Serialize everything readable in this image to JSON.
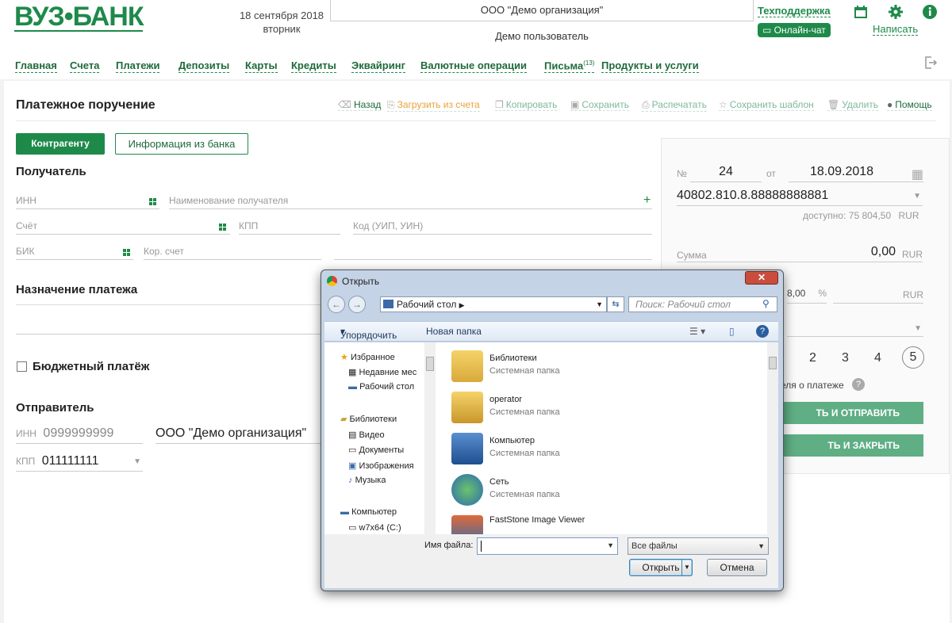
{
  "header": {
    "logo": "ВУЗ•БАНК",
    "date": "18 сентября 2018",
    "weekday": "вторник",
    "org": "ООО \"Демо организация\"",
    "user": "Демо пользователь",
    "support": "Техподдержка",
    "chat": "Онлайн-чат",
    "write": "Написать",
    "icons": [
      "calendar-icon",
      "gear-icon",
      "info-icon",
      "logout-icon"
    ]
  },
  "nav": {
    "items": [
      "Главная",
      "Счета",
      "Платежи",
      "Депозиты",
      "Карты",
      "Кредиты",
      "Эквайринг",
      "Валютные операции",
      "Письма",
      "Продукты и услуги"
    ],
    "letters_badge": "(13)"
  },
  "doc": {
    "title": "Платежное поручение",
    "toolbar": [
      "Назад",
      "Загрузить из счета",
      "Копировать",
      "Сохранить",
      "Распечатать",
      "Сохранить шаблон",
      "Удалить",
      "Помощь"
    ],
    "tab_counterparty": "Контрагенту",
    "tab_bankinfo": "Информация из банка",
    "recipient": {
      "heading": "Получатель",
      "inn_placeholder": "ИНН",
      "name_placeholder": "Наименование получателя",
      "account_placeholder": "Счёт",
      "kpp_placeholder": "КПП",
      "code_placeholder": "Код (УИП, УИН)",
      "bik_placeholder": "БИК",
      "corr_placeholder": "Кор. счет"
    },
    "purpose_heading": "Назначение платежа",
    "budget_label": "Бюджетный платёж",
    "sender": {
      "heading": "Отправитель",
      "inn_label": "ИНН",
      "inn_value": "0999999999",
      "name_value": "ООО \"Демо организация\"",
      "kpp_label": "КПП",
      "kpp_value": "011111111"
    }
  },
  "panel": {
    "no_label": "№",
    "no_value": "24",
    "from_label": "от",
    "date_value": "18.09.2018",
    "account": "40802.810.8.88888888881",
    "available": "доступно: 75 804,50",
    "currency": "RUR",
    "sum_label": "Сумма",
    "sum_value": "0,00",
    "vat_value": "8,00",
    "vat_pct": "%",
    "priority": [
      "2",
      "3",
      "4",
      "5"
    ],
    "notify_label": "еля о платеже",
    "btn_send": "ТЬ И ОТПРАВИТЬ",
    "btn_close": "ТЬ И ЗАКРЫТЬ"
  },
  "dialog": {
    "title": "Открыть",
    "address": "Рабочий стол",
    "search_placeholder": "Поиск: Рабочий стол",
    "organize": "Упорядочить",
    "new_folder": "Новая папка",
    "tree": [
      "Избранное",
      "Недавние мес",
      "Рабочий стол",
      "Библиотеки",
      "Видео",
      "Документы",
      "Изображения",
      "Музыка",
      "Компьютер",
      "w7x64 (C:)"
    ],
    "files": [
      {
        "name": "Библиотеки",
        "sub": "Системная папка"
      },
      {
        "name": "operator",
        "sub": "Системная папка"
      },
      {
        "name": "Компьютер",
        "sub": "Системная папка"
      },
      {
        "name": "Сеть",
        "sub": "Системная папка"
      },
      {
        "name": "FastStone Image Viewer",
        "sub": ""
      }
    ],
    "filename_label": "Имя файла:",
    "filetype": "Все файлы",
    "open_btn": "Открыть",
    "cancel_btn": "Отмена"
  }
}
